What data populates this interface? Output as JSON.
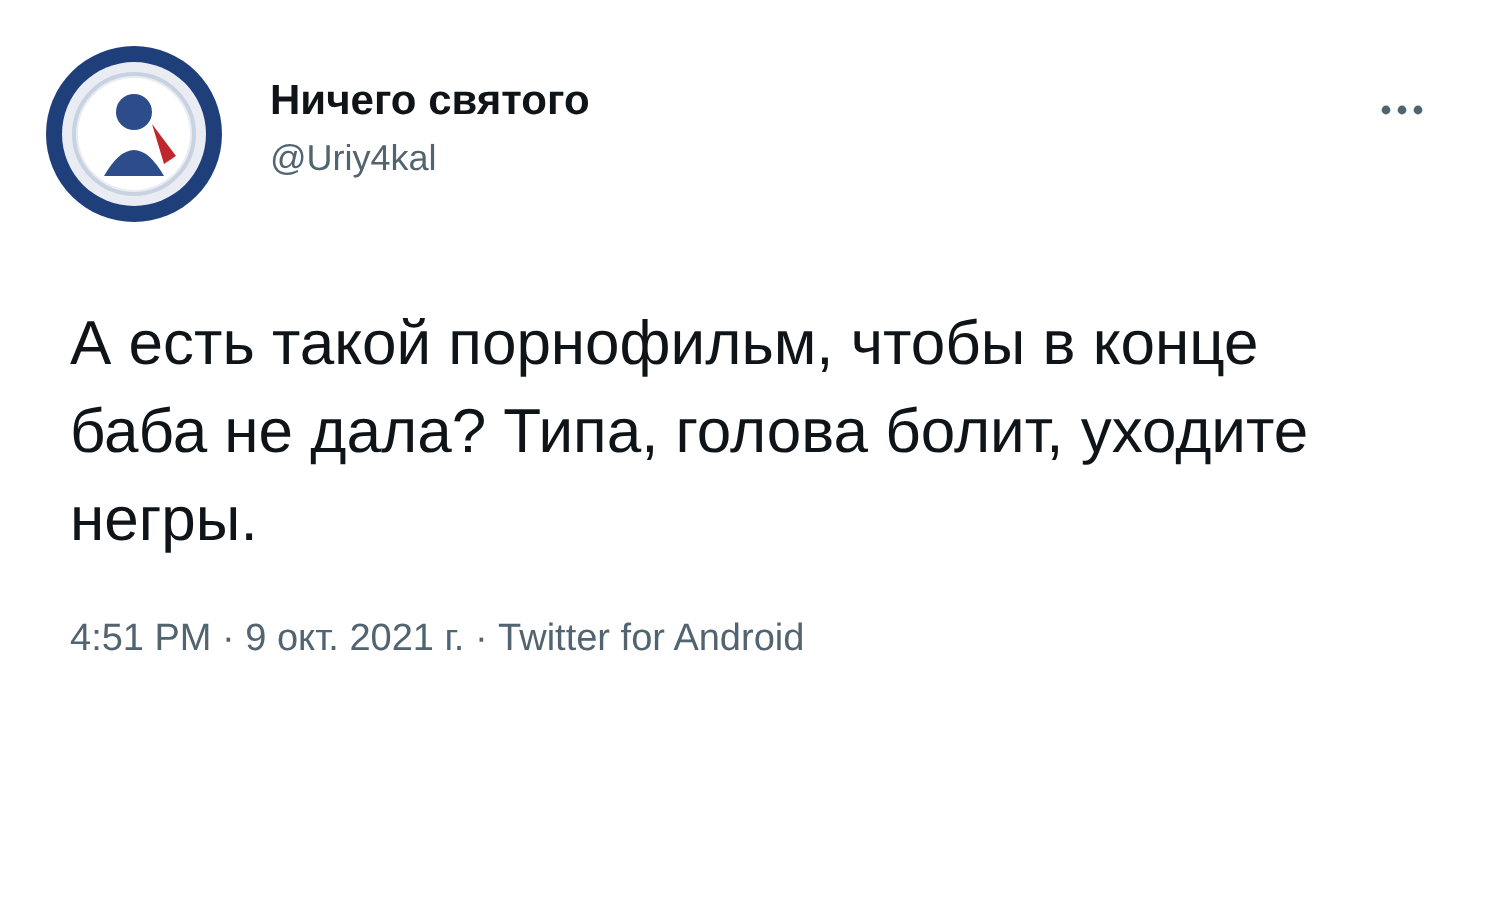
{
  "author": {
    "name": "Ничего святого",
    "handle": "@Uriy4kal"
  },
  "tweet": {
    "text": "А есть такой порнофильм, чтобы в конце баба не дала? Типа, голова болит, уходите негры."
  },
  "footer": {
    "meta": "4:51 PM · 9 окт. 2021 г. · Twitter for Android"
  }
}
